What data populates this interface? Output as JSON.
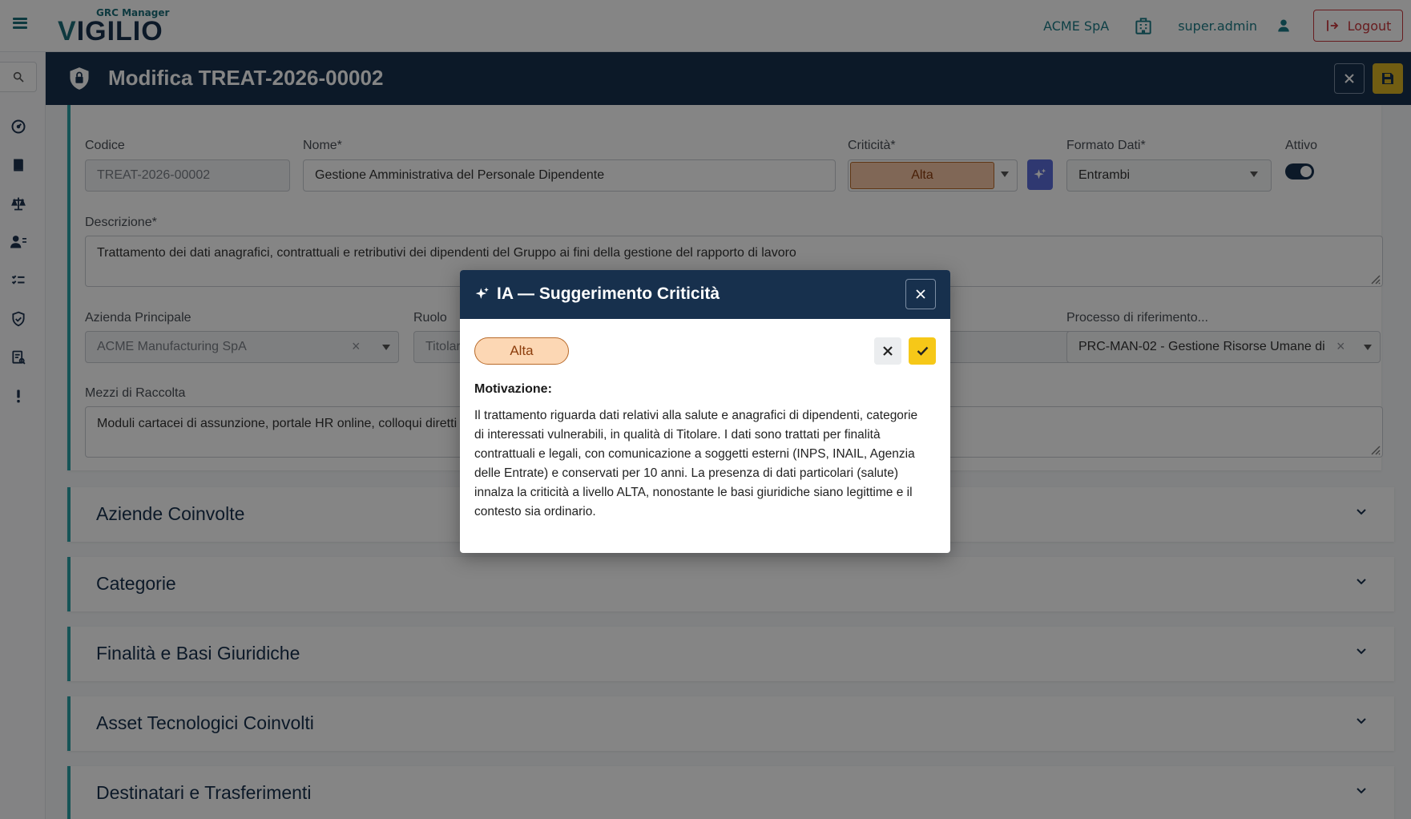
{
  "header": {
    "logo_subtitle": "GRC Manager",
    "logo_text": "IGILIO",
    "logo_letter": "V",
    "company": "ACME SpA",
    "user": "super.admin",
    "logout_label": "Logout"
  },
  "page": {
    "title": "Modifica TREAT-2026-00002"
  },
  "form": {
    "codice_label": "Codice",
    "codice_value": "TREAT-2026-00002",
    "nome_label": "Nome*",
    "nome_value": "Gestione Amministrativa del Personale Dipendente",
    "criticita_label": "Criticità*",
    "criticita_value": "Alta",
    "formato_label": "Formato Dati*",
    "formato_value": "Entrambi",
    "attivo_label": "Attivo",
    "attivo_on": true,
    "descrizione_label": "Descrizione*",
    "descrizione_value": "Trattamento dei dati anagrafici, contrattuali e retributivi dei dipendenti del Gruppo ai fini della gestione del rapporto di lavoro",
    "azienda_label": "Azienda Principale",
    "azienda_value": "ACME Manufacturing SpA",
    "ruolo_label": "Ruolo",
    "ruolo_value": "Titolare",
    "processo_label": "Processo di riferimento...",
    "processo_value": "PRC-MAN-02  - Gestione Risorse Umane di",
    "mezzi_label": "Mezzi di Raccolta",
    "mezzi_value": "Moduli cartacei di assunzione, portale HR online, colloqui diretti"
  },
  "sections": [
    {
      "title": "Aziende Coinvolte"
    },
    {
      "title": "Categorie"
    },
    {
      "title": "Finalità e Basi Giuridiche"
    },
    {
      "title": "Asset Tecnologici Coinvolti"
    },
    {
      "title": "Destinatari e Trasferimenti"
    }
  ],
  "modal": {
    "title": "IA — Suggerimento Criticità",
    "suggested_level": "Alta",
    "motivation_label": "Motivazione:",
    "motivation_text": "Il trattamento riguarda dati relativi alla salute e anagrafici di dipendenti, categorie di interessati vulnerabili, in qualità di Titolare. I dati sono trattati per finalità contrattuali e legali, con comunicazione a soggetti esterni (INPS, INAIL, Agenzia delle Entrate) e conservati per 10 anni. La presenza di dati particolari (salute) innalza la criticità a livello ALTA, nonostante le basi giuridiche siano legittime e il contesto sia ordinario."
  },
  "colors": {
    "navy": "#17304d",
    "teal": "#2aa1a8",
    "accent_yellow": "#f6c818",
    "logout_red": "#c8363c",
    "alta_fill": "#fcd7b4"
  }
}
